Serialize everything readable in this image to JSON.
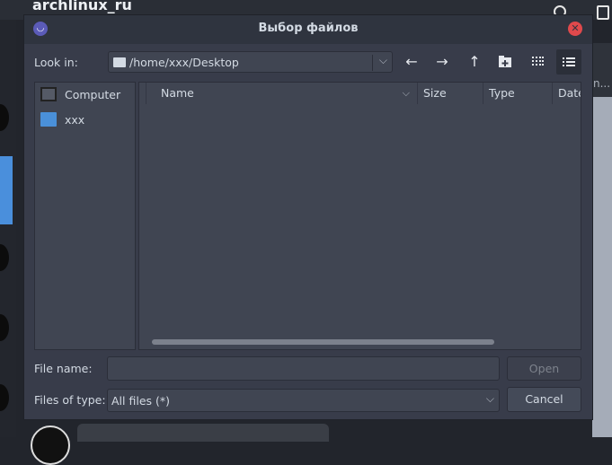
{
  "background": {
    "channel_title": "archlinux_ru",
    "partial_text": "n..."
  },
  "dialog": {
    "title": "Выбор файлов",
    "look_in_label": "Look in:",
    "look_in_path": "/home/xxx/Desktop",
    "toolbar": [
      "back-icon",
      "forward-icon",
      "up-icon",
      "new-folder-icon",
      "icon-view-icon",
      "list-view-icon"
    ],
    "sidebar": [
      {
        "label": "Computer",
        "icon": "computer-icon"
      },
      {
        "label": "xxx",
        "icon": "folder-icon"
      }
    ],
    "columns": [
      "Name",
      "Size",
      "Type",
      "Date"
    ],
    "file_name_label": "File name:",
    "file_name_value": "",
    "files_of_type_label": "Files of type:",
    "files_of_type_value": "All files (*)",
    "open_button": "Open",
    "cancel_button": "Cancel"
  },
  "colors": {
    "dialog_bg": "#383c4a",
    "field_bg": "#404552",
    "close": "#e0494c",
    "folder": "#4a90d9"
  }
}
